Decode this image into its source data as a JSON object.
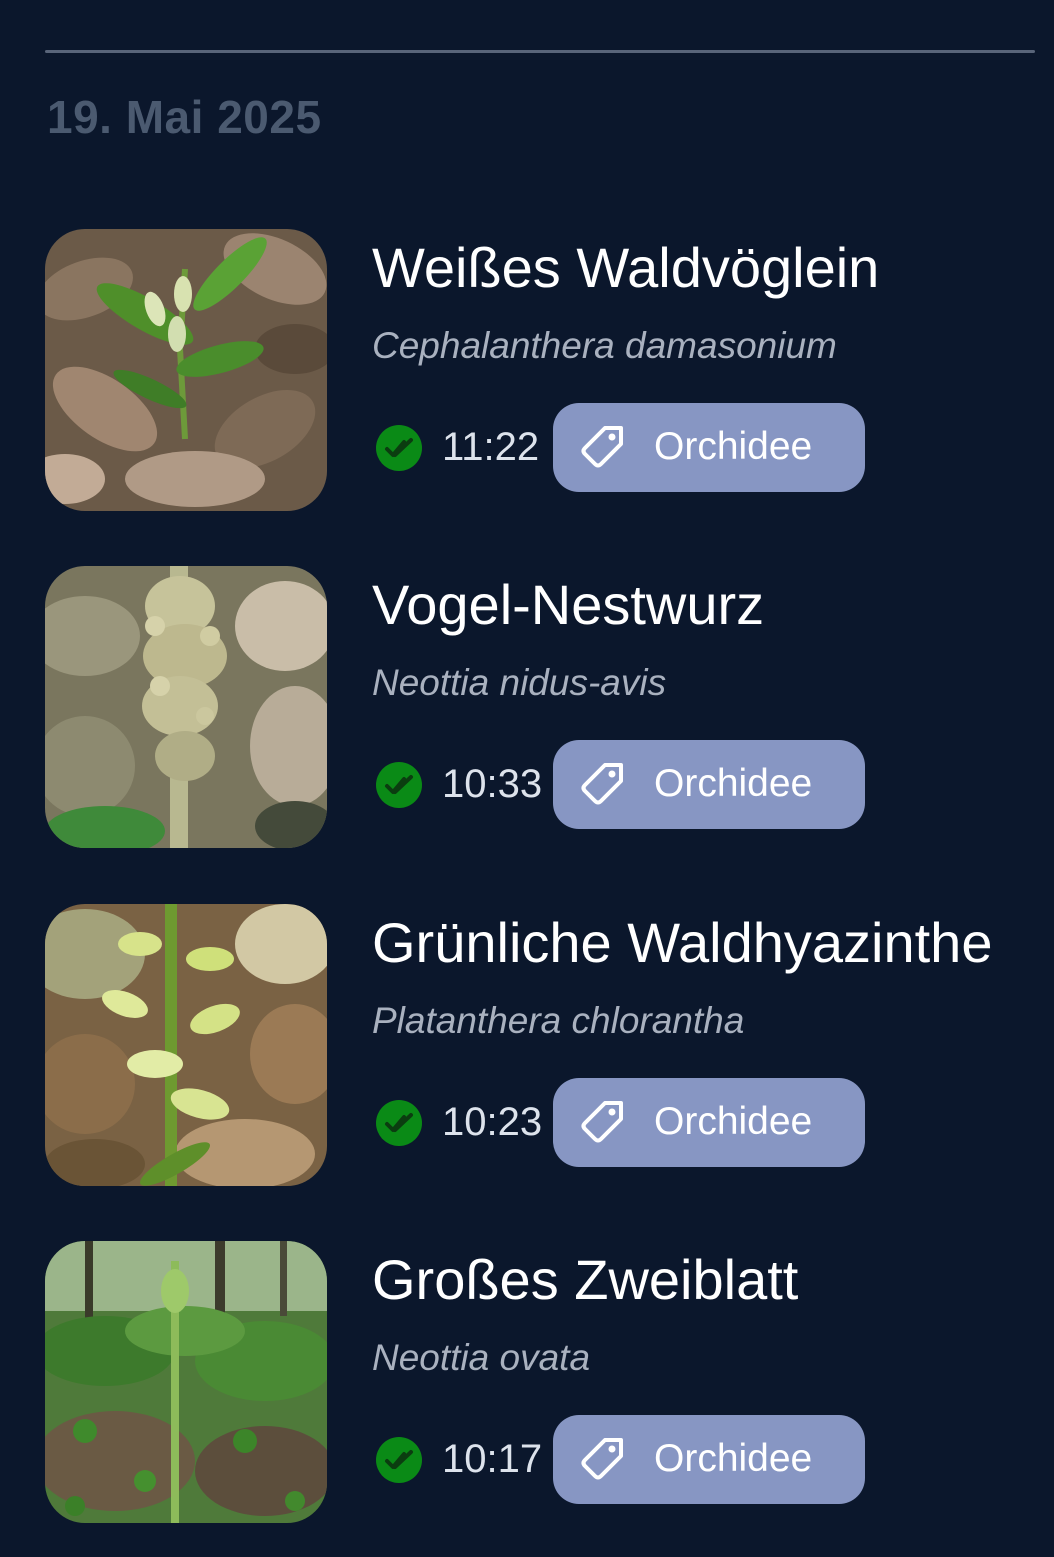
{
  "section": {
    "date": "19. Mai 2025"
  },
  "observations": [
    {
      "common_name": "Weißes Waldvöglein",
      "latin_name": "Cephalanthera damasonium",
      "time": "11:22",
      "tag": "Orchidee",
      "status": "verified",
      "status_icon": "double-check-icon"
    },
    {
      "common_name": "Vogel-Nestwurz",
      "latin_name": "Neottia nidus-avis",
      "time": "10:33",
      "tag": "Orchidee",
      "status": "verified",
      "status_icon": "double-check-icon"
    },
    {
      "common_name": "Grünliche Waldhyazinthe",
      "latin_name": "Platanthera chlorantha",
      "time": "10:23",
      "tag": "Orchidee",
      "status": "verified",
      "status_icon": "double-check-icon"
    },
    {
      "common_name": "Großes Zweiblatt",
      "latin_name": "Neottia ovata",
      "time": "10:17",
      "tag": "Orchidee",
      "status": "verified",
      "status_icon": "double-check-icon"
    }
  ],
  "colors": {
    "background": "#0b172c",
    "chip": "#8796c3",
    "status_green": "#0a8a16",
    "date_header": "#4b5a70"
  }
}
